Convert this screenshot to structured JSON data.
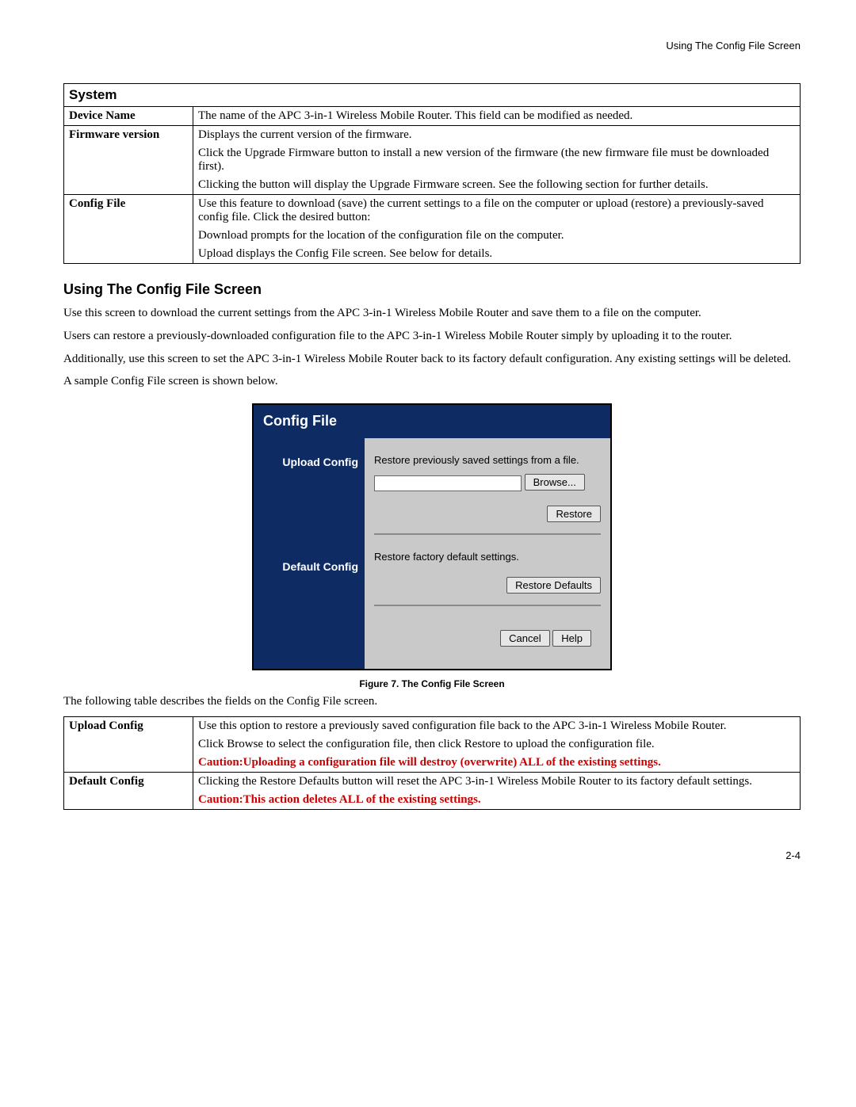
{
  "header": {
    "label": "Using The Config File Screen"
  },
  "table1": {
    "section_head": "System",
    "rows": [
      {
        "label": "Device Name",
        "paras": [
          "The name of the APC 3-in-1 Wireless Mobile Router. This field can be modified as needed."
        ]
      },
      {
        "label": "Firmware version",
        "paras": [
          "Displays the current version of the firmware.",
          "Click the Upgrade Firmware button to install a new version of the firmware (the new firmware file must be downloaded first).",
          "Clicking the button will display the Upgrade Firmware screen. See the following section for further details."
        ]
      },
      {
        "label": "Config File",
        "paras": [
          "Use this feature to download (save) the current settings to a file on the computer or upload (restore) a previously-saved config file. Click the desired button:",
          "Download prompts for the location of the configuration file on the computer.",
          "Upload displays the Config File screen. See below for details."
        ]
      }
    ]
  },
  "section_title": "Using The Config File Screen",
  "body": {
    "p1": "Use this screen to download the current settings from the APC 3-in-1 Wireless Mobile Router and save them to a file on the computer.",
    "p2": "Users can restore a previously-downloaded configuration file to the APC 3-in-1 Wireless Mobile Router simply by uploading it to the router.",
    "p3": "Additionally, use this screen to set the APC 3-in-1 Wireless Mobile Router back to its factory default configuration. Any existing settings will be deleted.",
    "p4": "A sample Config File screen is shown below."
  },
  "panel": {
    "title": "Config File",
    "upload_label": "Upload Config",
    "upload_desc": "Restore previously saved settings from a file.",
    "browse_btn": "Browse...",
    "restore_btn": "Restore",
    "default_label": "Default Config",
    "default_desc": "Restore factory default settings.",
    "restore_defaults_btn": "Restore Defaults",
    "cancel_btn": "Cancel",
    "help_btn": "Help"
  },
  "figure_caption": "Figure 7. The Config File Screen",
  "post_figure_text": "The following table describes the fields on the Config File screen.",
  "table2": {
    "rows": [
      {
        "label": "Upload Config",
        "paras": [
          "Use this option to restore a previously saved configuration file back to the APC 3-in-1 Wireless Mobile Router.",
          "Click Browse to select the configuration file, then click Restore to upload the configuration file."
        ],
        "caution": "Caution:Uploading a configuration file will destroy (overwrite) ALL of the existing settings."
      },
      {
        "label": "Default Config",
        "paras": [
          "Clicking the Restore Defaults button will reset the APC 3-in-1 Wireless Mobile Router to its factory default settings."
        ],
        "caution": "Caution:This action deletes ALL of the existing settings."
      }
    ]
  },
  "page_number": "2-4"
}
